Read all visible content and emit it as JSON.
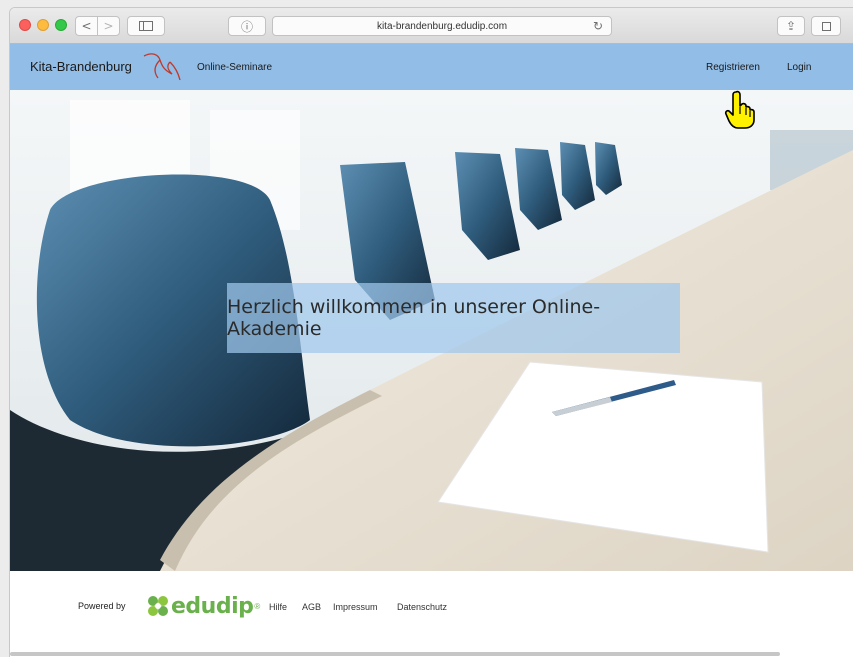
{
  "browser": {
    "url": "kita-brandenburg.edudip.com",
    "buttons": {
      "back": "<",
      "forward": ">",
      "info": "ⓘ",
      "reload": "↻",
      "share": "⇪"
    }
  },
  "header": {
    "brand": "Kita-Brandenburg",
    "nav_seminare": "Online-Seminare",
    "nav_register": "Registrieren",
    "nav_login": "Login",
    "color": "#92bde6"
  },
  "hero": {
    "title": "Herzlich willkommen in unserer Online-Akademie"
  },
  "footer": {
    "powered_by": "Powered by",
    "logo_text": "edudip",
    "logo_reg": "®",
    "links": [
      "Hilfe",
      "AGB",
      "Impressum",
      "Datenschutz"
    ]
  }
}
